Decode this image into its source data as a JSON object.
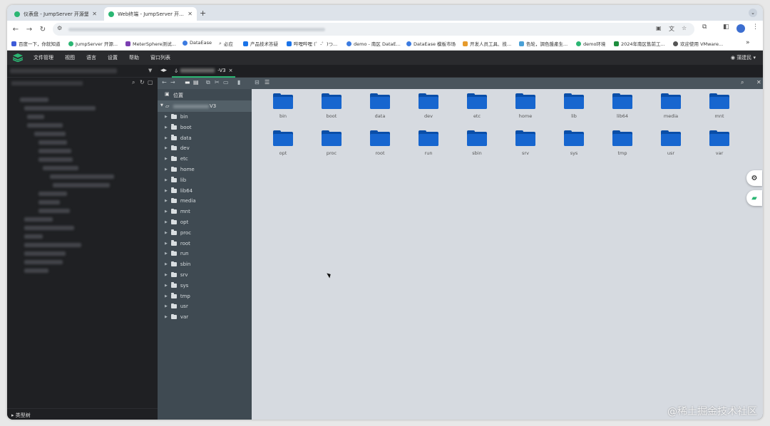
{
  "browser": {
    "tabs": [
      {
        "title": "仪表盘 - JumpServer 开源堡...",
        "active": false
      },
      {
        "title": "Web终端 - JumpServer 开...",
        "active": true
      }
    ],
    "new_tab": "+",
    "bookmarks": [
      {
        "label": "百度一下，你就知道",
        "color": "#3d5bd8"
      },
      {
        "label": "JumpServer 开源...",
        "color": "#2bb673"
      },
      {
        "label": "MeterSphere测试...",
        "color": "#7b3fb2"
      },
      {
        "label": "DataEase",
        "color": "#3c7be0"
      },
      {
        "label": "必应",
        "color": "#888888"
      },
      {
        "label": "产品技术答疑",
        "color": "#1a73e8"
      },
      {
        "label": "哔哩哔哩 (゜-゜)つ...",
        "color": "#1a73e8"
      },
      {
        "label": "demo - 南区 DataE...",
        "color": "#3c7be0"
      },
      {
        "label": "DataEase 模板市场",
        "color": "#3c7be0"
      },
      {
        "label": "开发人员工具、技...",
        "color": "#e69b2c"
      },
      {
        "label": "色轮，調色盤產生...",
        "color": "#4aa0d6"
      },
      {
        "label": "demo环境",
        "color": "#2bb673"
      },
      {
        "label": "2024年南区售前工...",
        "color": "#1e8e3e"
      },
      {
        "label": "欢迎使用 VMware...",
        "color": "#555555"
      }
    ]
  },
  "app": {
    "menu": [
      "文件管理",
      "视图",
      "语言",
      "设置",
      "帮助",
      "窗口列表"
    ],
    "user": "蒲建民 ▾",
    "session_tab_suffix": "-V3",
    "session_close": "×",
    "tree_location": "位置",
    "tree_root_suffix": "V3",
    "left_footer": "类型树",
    "folders": [
      "bin",
      "boot",
      "data",
      "dev",
      "etc",
      "home",
      "lib",
      "lib64",
      "media",
      "mnt",
      "opt",
      "proc",
      "root",
      "run",
      "sbin",
      "srv",
      "sys",
      "tmp",
      "usr",
      "var"
    ]
  },
  "watermark": "@稀土掘金技术社区"
}
